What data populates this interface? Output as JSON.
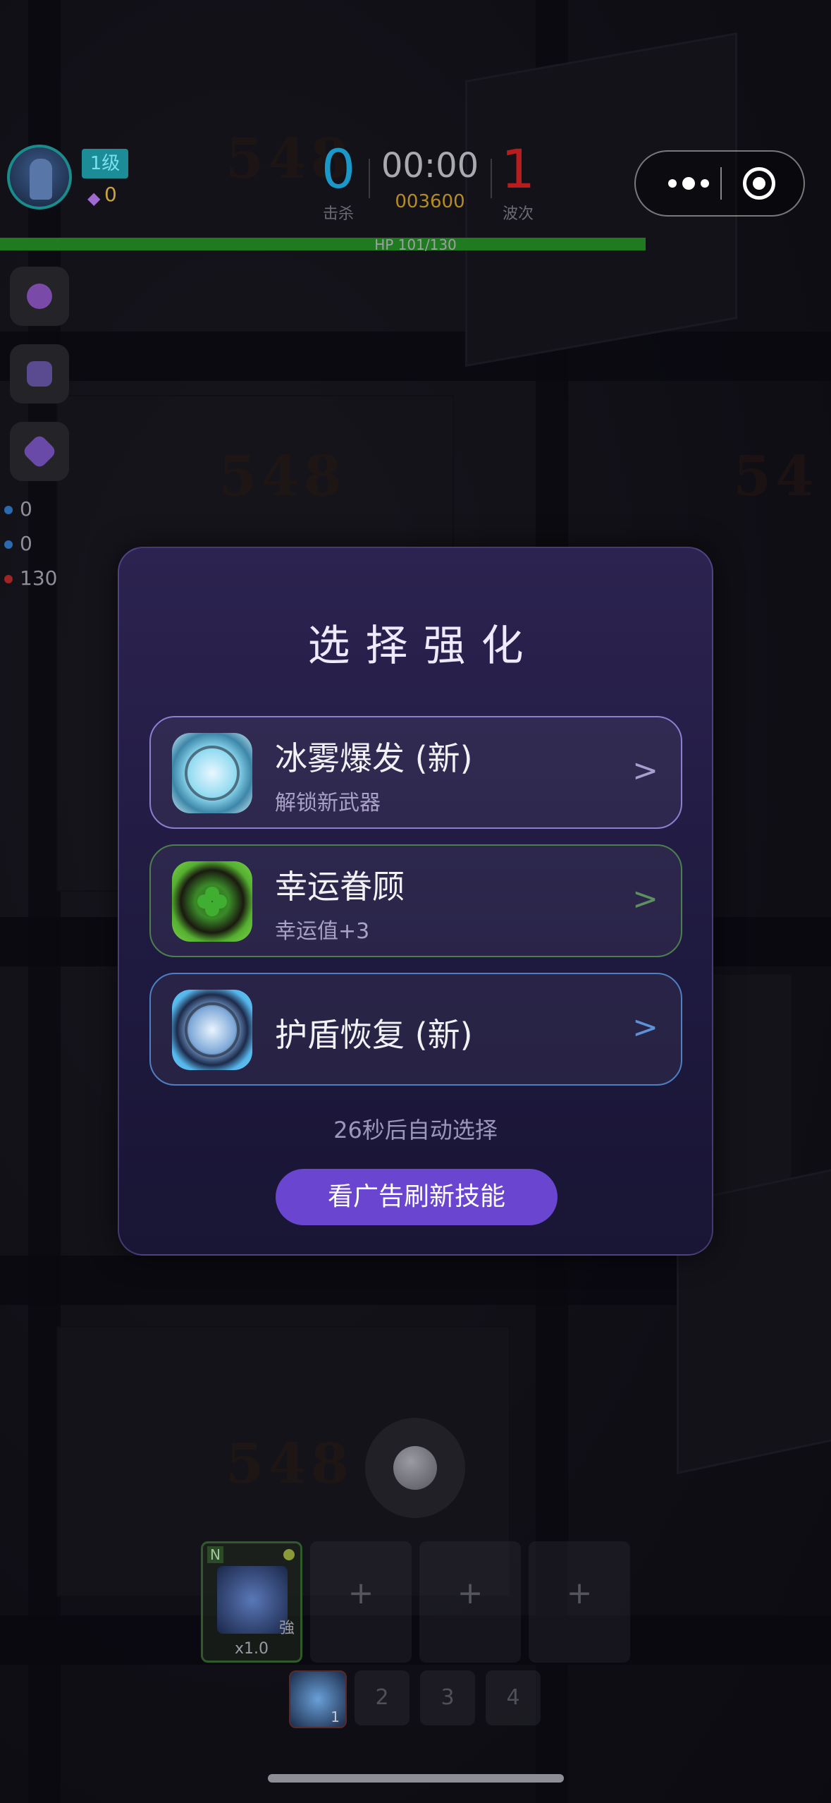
{
  "hud": {
    "level": "1级",
    "gems": "0",
    "kills": "0",
    "kills_label": "击杀",
    "timer": "00:00",
    "score": "003600",
    "wave": "1",
    "wave_label": "波次",
    "hp_text": "HP 101/130",
    "hp_fraction": 0.777
  },
  "side_stats": [
    "0",
    "0",
    "130"
  ],
  "modal": {
    "title": "选择强化",
    "options": [
      {
        "name": "冰雾爆发 (新)",
        "desc": "解锁新武器",
        "arrow": ">"
      },
      {
        "name": "幸运眷顾",
        "desc": "幸运值+3",
        "arrow": ">"
      },
      {
        "name": "护盾恢复 (新)",
        "desc": "",
        "arrow": ">"
      }
    ],
    "countdown": "26秒后自动选择",
    "ad_button": "看广告刷新技能"
  },
  "weapon_slots": {
    "main": {
      "tag": "N",
      "badge": "強",
      "multiplier": "x1.0"
    },
    "empty": [
      "+",
      "+",
      "+"
    ]
  },
  "skill_bar": {
    "slot1_count": "1",
    "others": [
      "2",
      "3",
      "4"
    ]
  },
  "colors": {
    "kills": "#1a98c8",
    "wave": "#b81c1c",
    "score": "#b48c22",
    "hp": "#1f7a20",
    "ad_button": "#6a45d0",
    "modal_bg": "#231d46"
  },
  "icons": [
    "more-dots-icon",
    "target-icon",
    "ice-burst-icon",
    "clover-icon",
    "shield-icon",
    "gem-icon"
  ]
}
